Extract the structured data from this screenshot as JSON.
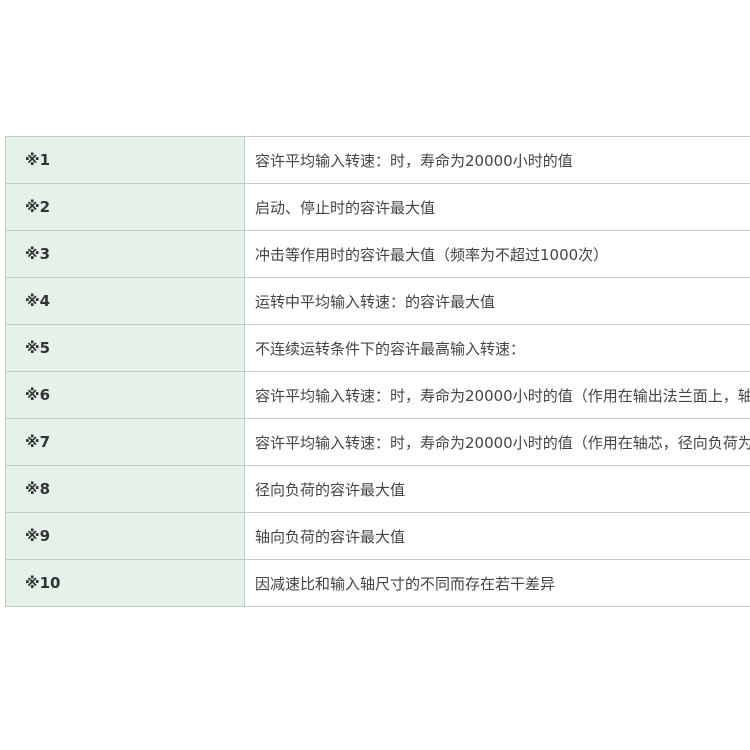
{
  "notes": [
    {
      "mark": "※1",
      "text": "容许平均输入转速：时，寿命为20000小时的值"
    },
    {
      "mark": "※2",
      "text": "启动、停止时的容许最大值"
    },
    {
      "mark": "※3",
      "text": "冲击等作用时的容许最大值（频率为不超过1000次）"
    },
    {
      "mark": "※4",
      "text": "运转中平均输入转速：的容许最大值"
    },
    {
      "mark": "※5",
      "text": "不连续运转条件下的容许最高输入转速："
    },
    {
      "mark": "※6",
      "text": "容许平均输入转速：时，寿命为20000小时的值（作用在输出法兰面上，轴"
    },
    {
      "mark": "※7",
      "text": "容许平均输入转速：时，寿命为20000小时的值（作用在轴芯，径向负荷为"
    },
    {
      "mark": "※8",
      "text": "径向负荷的容许最大值"
    },
    {
      "mark": "※9",
      "text": "轴向负荷的容许最大值"
    },
    {
      "mark": "※10",
      "text": "因减速比和输入轴尺寸的不同而存在若干差异"
    }
  ],
  "colors": {
    "mark_cell_bg": "#e4f2ea",
    "border": "#c6cbc8",
    "text": "#444444"
  }
}
